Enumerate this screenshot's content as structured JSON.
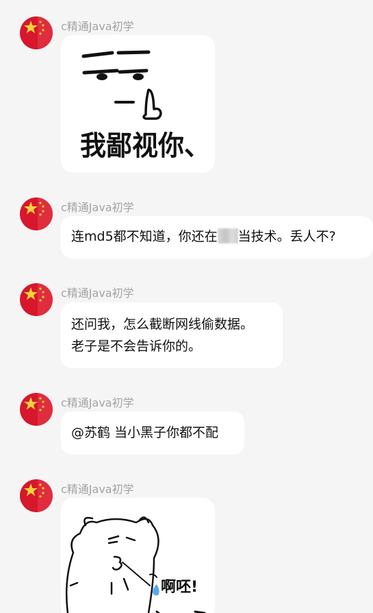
{
  "messages": [
    {
      "sender": "c精通Java初学",
      "type": "sticker",
      "sticker_name": "contempt-sticker",
      "sticker_text": "我鄙视你、"
    },
    {
      "sender": "c精通Java初学",
      "type": "text",
      "text_before": "连md5都不知道，你还在",
      "redacted_glyph": "安",
      "text_after": "当技术。丢人不?"
    },
    {
      "sender": "c精通Java初学",
      "type": "text",
      "lines": [
        "还问我，怎么截断网线偷数据。",
        "老子是不会告诉你的。"
      ]
    },
    {
      "sender": "c精通Java初学",
      "type": "text",
      "text": "@苏鹤 当小黑子你都不配"
    },
    {
      "sender": "c精通Java初学",
      "type": "sticker",
      "sticker_name": "bear-spit-sticker",
      "sticker_text": "啊呸!"
    }
  ],
  "avatar_colors": {
    "primary": "#d7172c",
    "star": "#f7d23a"
  }
}
